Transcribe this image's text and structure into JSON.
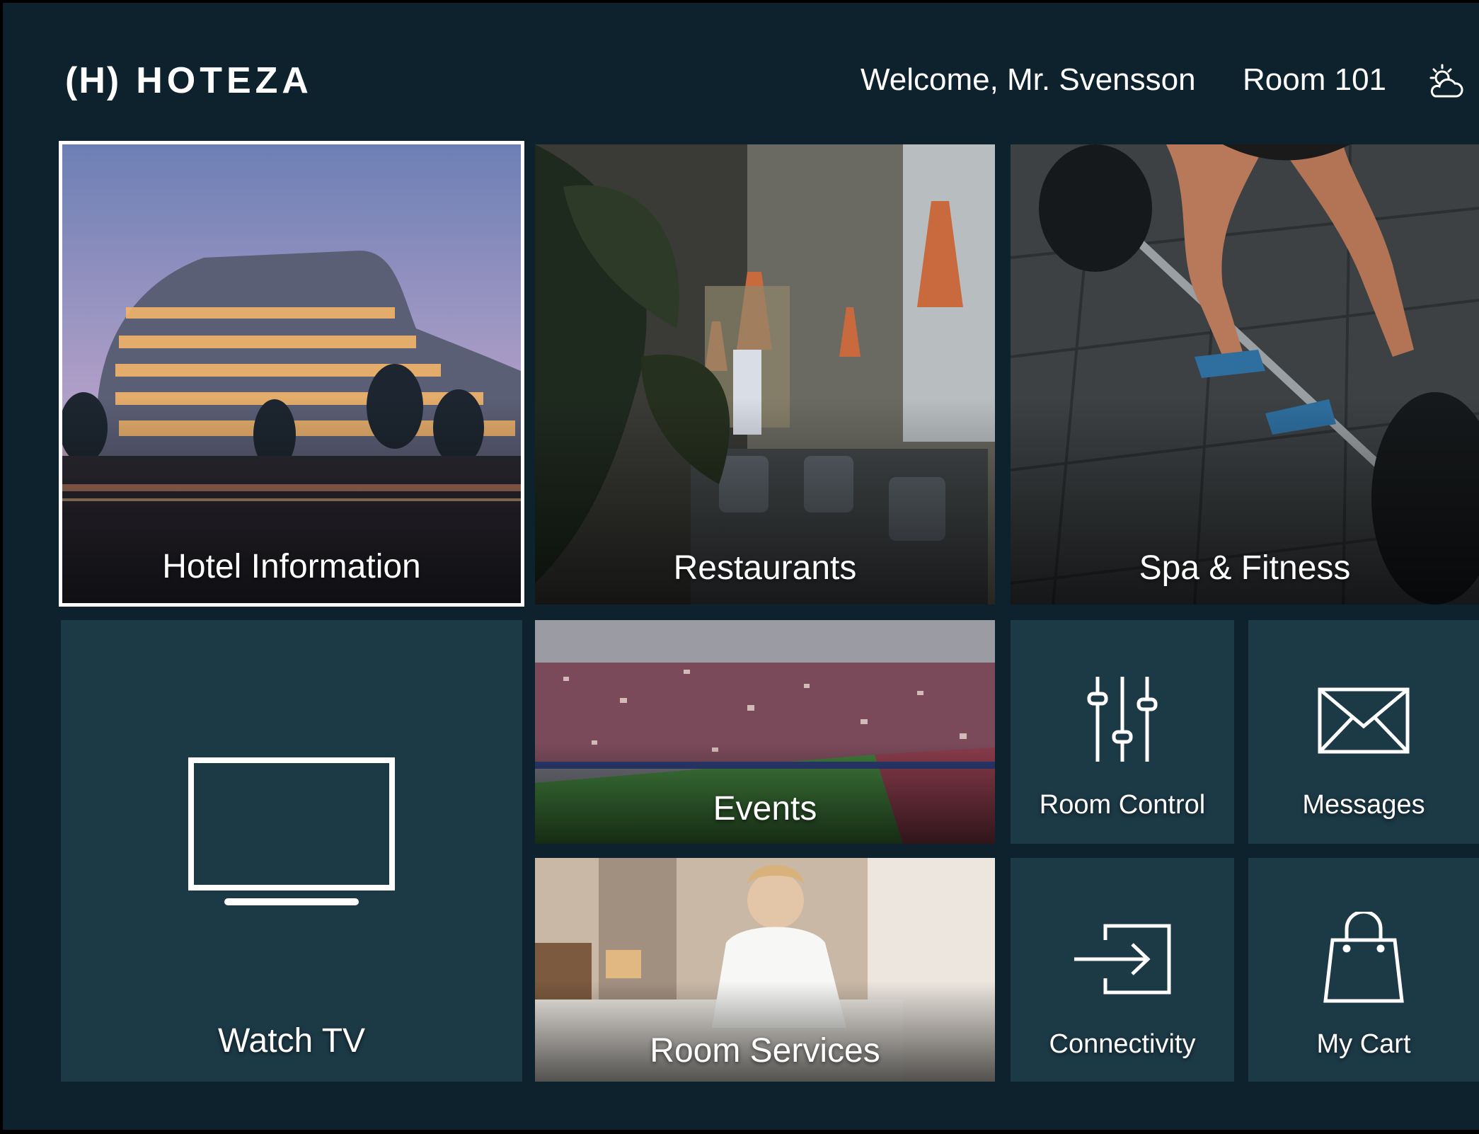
{
  "header": {
    "logo_mark": "(H)",
    "logo_text": "HOTEZA",
    "welcome": "Welcome, Mr. Svensson",
    "room": "Room 101",
    "weather_icon": "partly-cloudy-icon"
  },
  "tiles": {
    "hotel_information": "Hotel Information",
    "restaurants": "Restaurants",
    "spa_fitness": "Spa & Fitness",
    "watch_tv": "Watch TV",
    "events": "Events",
    "room_services": "Room Services",
    "room_control": "Room Control",
    "messages": "Messages",
    "connectivity": "Connectivity",
    "my_cart": "My Cart"
  },
  "icons": {
    "watch_tv": "tv-icon",
    "room_control": "sliders-icon",
    "messages": "envelope-icon",
    "connectivity": "login-arrow-icon",
    "my_cart": "shopping-bag-icon"
  },
  "colors": {
    "background": "#0d222c",
    "tile": "#1c3946",
    "focus_outline": "#ffffff"
  },
  "focused_tile": "Hotel Information"
}
